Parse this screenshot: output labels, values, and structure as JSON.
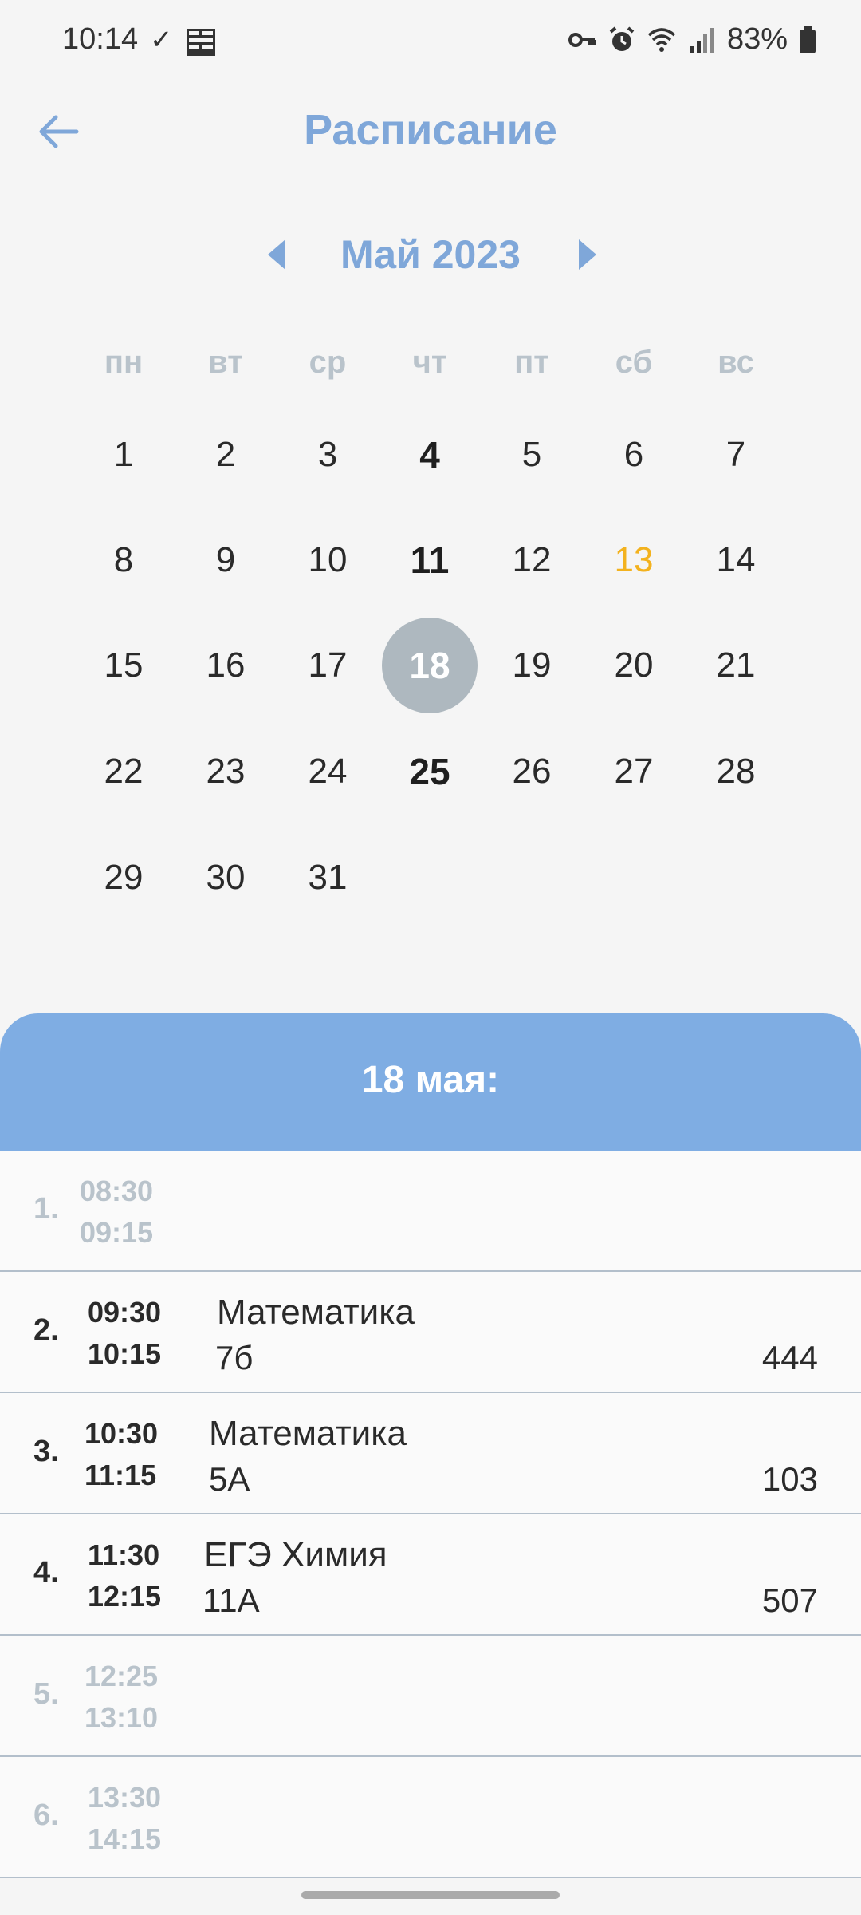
{
  "status_bar": {
    "time": "10:14",
    "check": "✓",
    "battery": "83%",
    "icons": [
      "vpn-key-icon",
      "alarm-icon",
      "wifi-icon",
      "signal-icon",
      "battery-icon"
    ]
  },
  "app_bar": {
    "title": "Расписание"
  },
  "calendar": {
    "month_label": "Май 2023",
    "weekdays": [
      "пн",
      "вт",
      "ср",
      "чт",
      "пт",
      "сб",
      "вс"
    ],
    "weeks": [
      [
        "1",
        "2",
        "3",
        "4",
        "5",
        "6",
        "7"
      ],
      [
        "8",
        "9",
        "10",
        "11",
        "12",
        "13",
        "14"
      ],
      [
        "15",
        "16",
        "17",
        "18",
        "19",
        "20",
        "21"
      ],
      [
        "22",
        "23",
        "24",
        "25",
        "26",
        "27",
        "28"
      ],
      [
        "29",
        "30",
        "31",
        "",
        "",
        "",
        ""
      ]
    ],
    "bold_days": [
      "4",
      "11",
      "18",
      "25"
    ],
    "highlight_day": "13",
    "selected_day": "18",
    "colors": {
      "accent": "#7fa7d9",
      "highlight": "#f3b21e",
      "selected": "#aeb8bf"
    }
  },
  "schedule": {
    "header": "18 мая:",
    "lessons": [
      {
        "index": "1.",
        "start": "08:30",
        "end": "09:15",
        "subject": "",
        "class": "",
        "room": ""
      },
      {
        "index": "2.",
        "start": "09:30",
        "end": "10:15",
        "subject": "Математика",
        "class": "7б",
        "room": "444"
      },
      {
        "index": "3.",
        "start": "10:30",
        "end": "11:15",
        "subject": "Математика",
        "class": "5А",
        "room": "103"
      },
      {
        "index": "4.",
        "start": "11:30",
        "end": "12:15",
        "subject": "ЕГЭ Химия",
        "class": "11А",
        "room": "507"
      },
      {
        "index": "5.",
        "start": "12:25",
        "end": "13:10",
        "subject": "",
        "class": "",
        "room": ""
      },
      {
        "index": "6.",
        "start": "13:30",
        "end": "14:15",
        "subject": "",
        "class": "",
        "room": ""
      }
    ]
  }
}
